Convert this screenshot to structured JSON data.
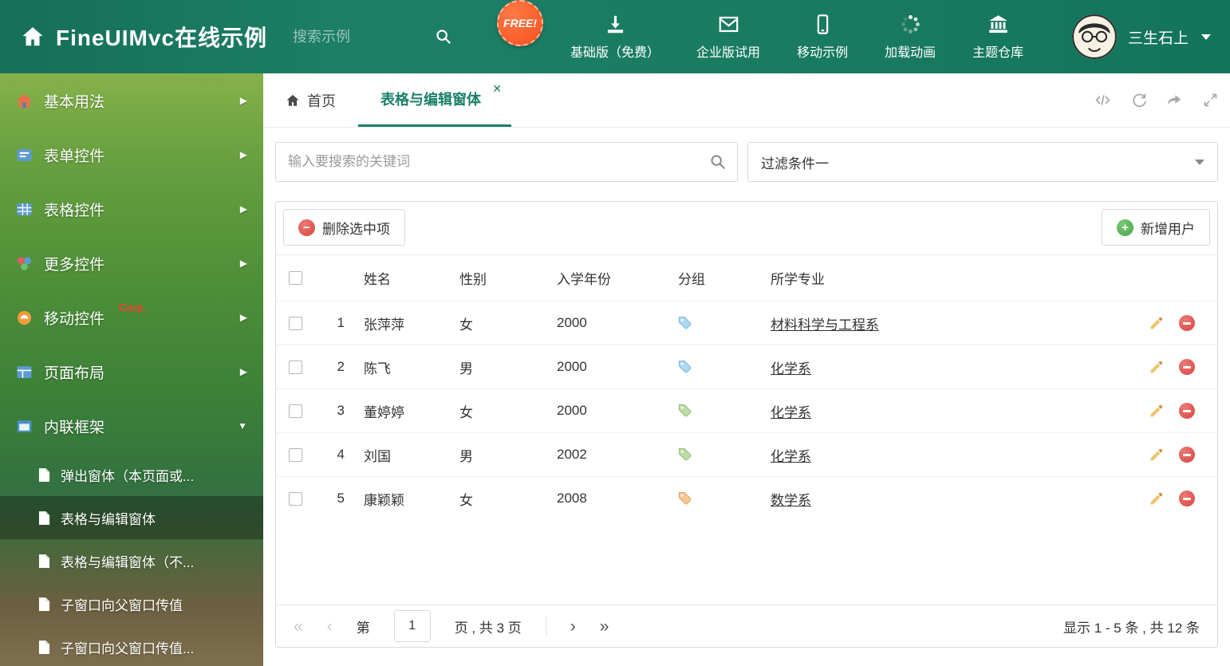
{
  "colors": {
    "accent": "#1a8069",
    "header_bg": "#187a5f",
    "free_badge": "#f4501e",
    "corp_badge": "#ff3b30",
    "danger": "#d9433f",
    "success": "#47a447",
    "tag_blue": "#aed8f0",
    "tag_green": "#bcdca6",
    "tag_orange": "#f6c793"
  },
  "header": {
    "title": "FineUIMvc在线示例",
    "search_placeholder": "搜索示例",
    "free_badge": "FREE!",
    "nav_items": [
      {
        "label": "基础版（免费）",
        "icon": "download-icon"
      },
      {
        "label": "企业版试用",
        "icon": "envelope-icon"
      },
      {
        "label": "移动示例",
        "icon": "mobile-icon"
      },
      {
        "label": "加载动画",
        "icon": "spinner-icon"
      },
      {
        "label": "主题仓库",
        "icon": "bank-icon"
      }
    ],
    "username": "三生石上"
  },
  "sidebar": {
    "items": [
      {
        "label": "基本用法"
      },
      {
        "label": "表单控件"
      },
      {
        "label": "表格控件"
      },
      {
        "label": "更多控件"
      },
      {
        "label": "移动控件",
        "badge": "Corp."
      },
      {
        "label": "页面布局"
      },
      {
        "label": "内联框架"
      }
    ],
    "subitems": [
      {
        "label": "弹出窗体（本页面或..."
      },
      {
        "label": "表格与编辑窗体"
      },
      {
        "label": "表格与编辑窗体（不..."
      },
      {
        "label": "子窗口向父窗口传值"
      },
      {
        "label": "子窗口向父窗口传值..."
      }
    ]
  },
  "tabs": [
    {
      "label": "首页"
    },
    {
      "label": "表格与编辑窗体"
    }
  ],
  "filters": {
    "search_placeholder": "输入要搜索的关键词",
    "filter_value": "过滤条件一"
  },
  "toolbar": {
    "delete_label": "删除选中项",
    "add_label": "新增用户"
  },
  "table": {
    "columns": [
      "姓名",
      "性别",
      "入学年份",
      "分组",
      "所学专业"
    ],
    "rows": [
      {
        "num": "1",
        "name": "张萍萍",
        "gender": "女",
        "year": "2000",
        "tag": "blue",
        "major": "材料科学与工程系"
      },
      {
        "num": "2",
        "name": "陈飞",
        "gender": "男",
        "year": "2000",
        "tag": "blue",
        "major": "化学系"
      },
      {
        "num": "3",
        "name": "董婷婷",
        "gender": "女",
        "year": "2000",
        "tag": "green",
        "major": "化学系"
      },
      {
        "num": "4",
        "name": "刘国",
        "gender": "男",
        "year": "2002",
        "tag": "green",
        "major": "化学系"
      },
      {
        "num": "5",
        "name": "康颖颖",
        "gender": "女",
        "year": "2008",
        "tag": "orange",
        "major": "数学系"
      }
    ]
  },
  "pagination": {
    "page_prefix": "第",
    "current_page": "1",
    "page_suffix": "页 , 共 3 页",
    "summary": "显示 1 - 5 条 , 共 12 条"
  }
}
